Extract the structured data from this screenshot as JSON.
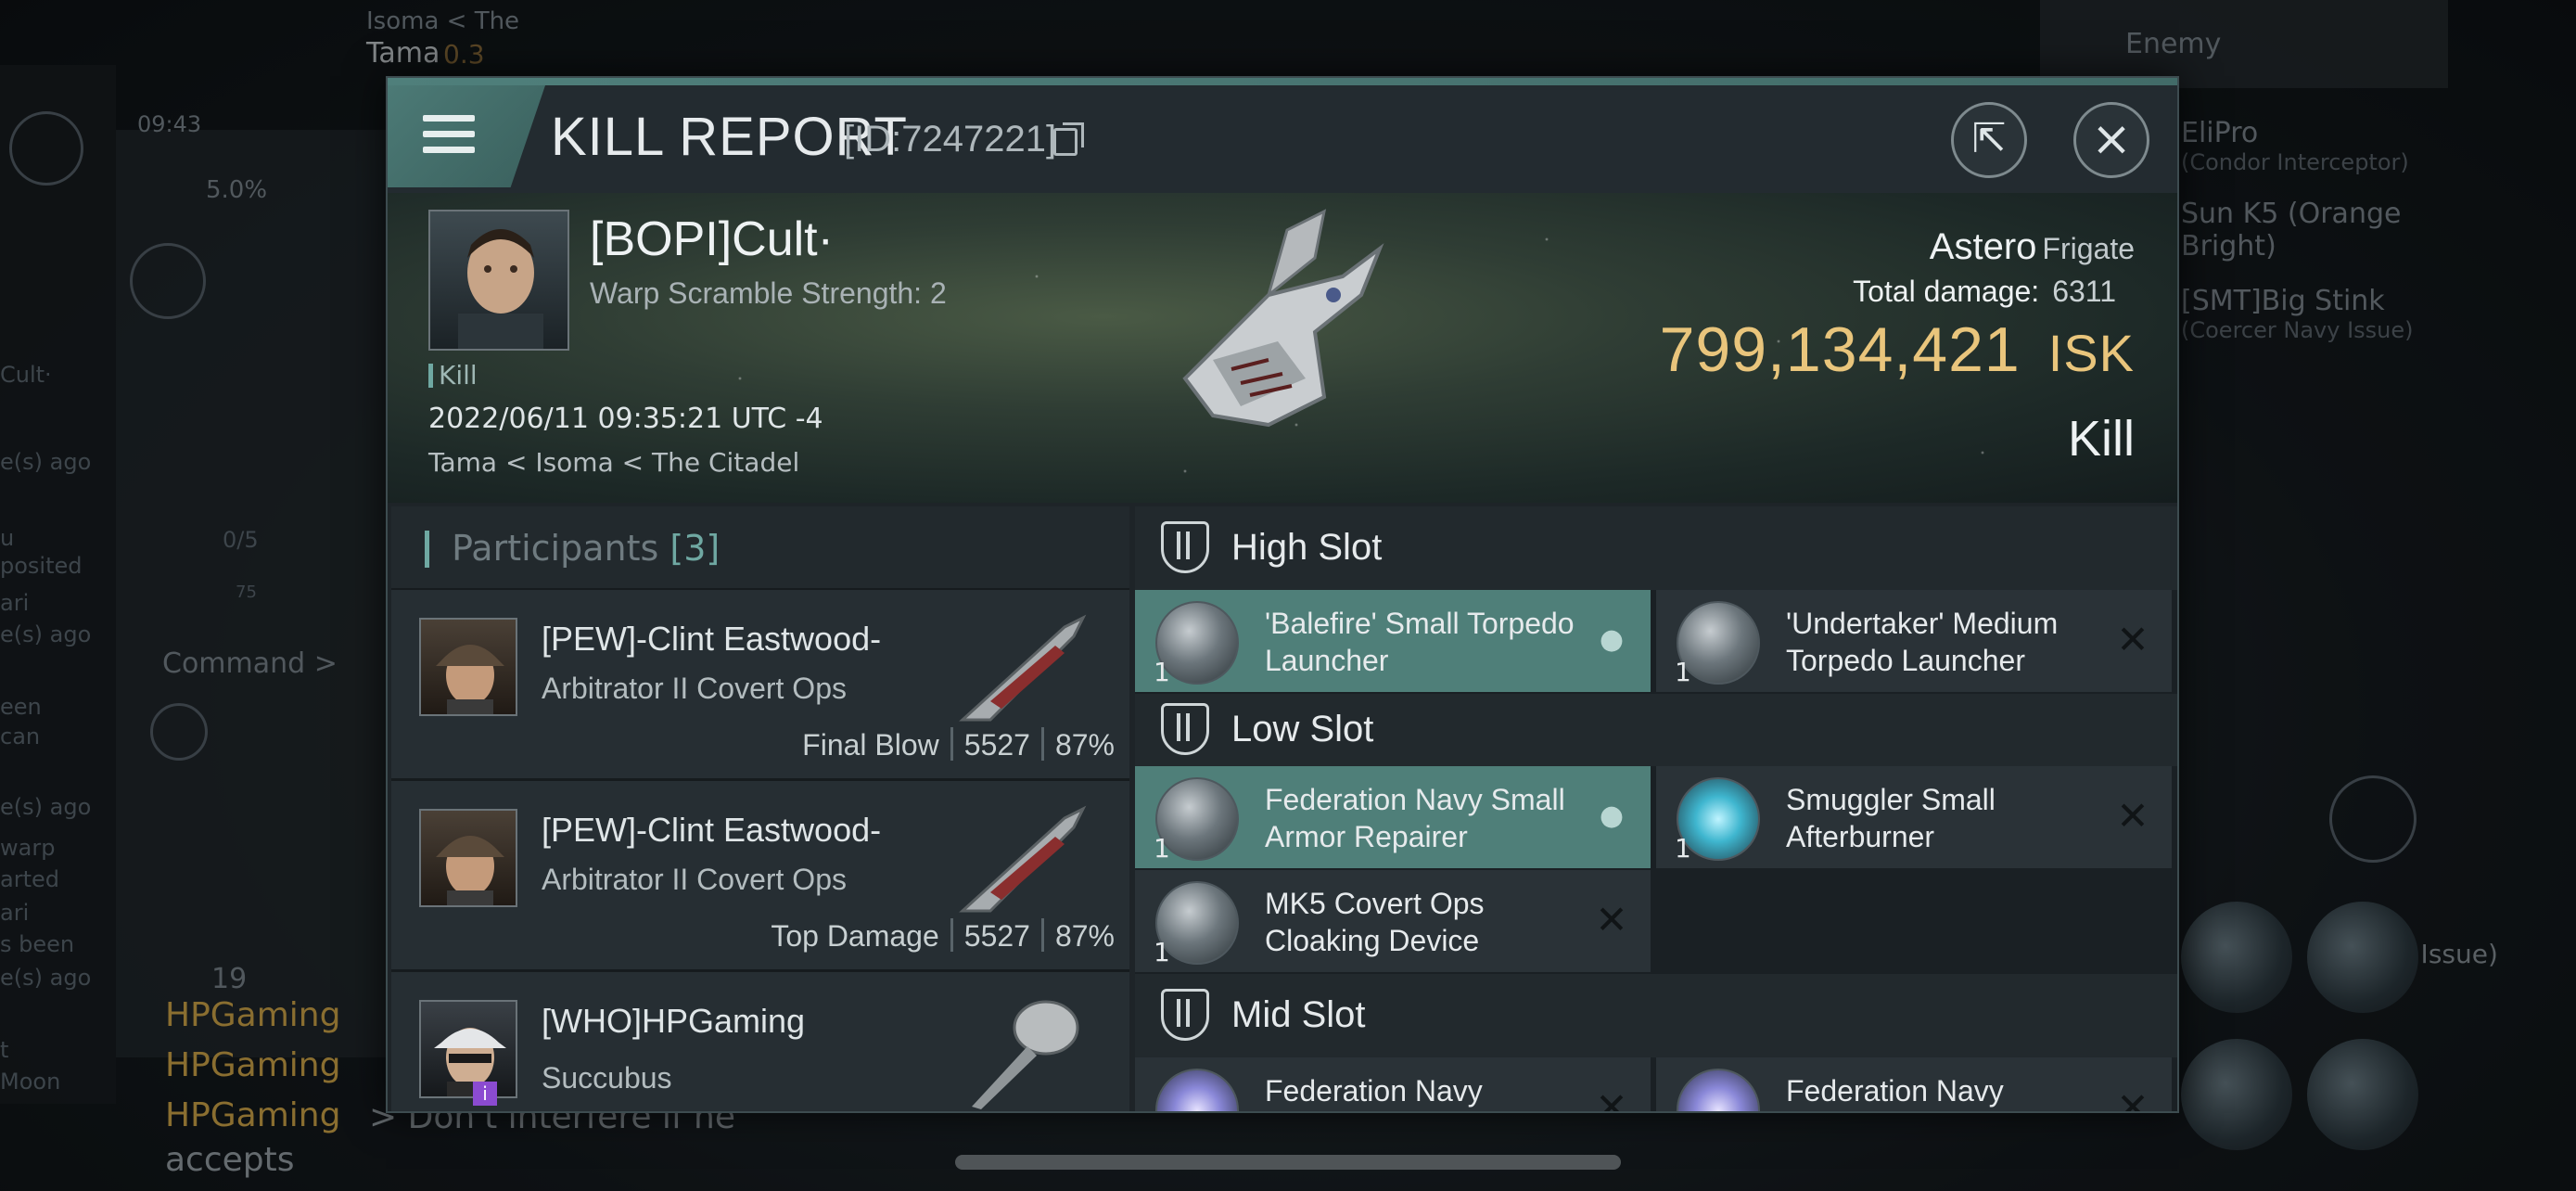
{
  "background": {
    "top_left": {
      "system_line": "Isoma < The",
      "location": "Tama",
      "security": "0.3",
      "clock": "09:43",
      "cargo_pct": "5.0%"
    },
    "chat_snippets": [
      "Cult·",
      "e(s) ago",
      "u",
      "posited",
      "ari",
      "e(s) ago",
      "een",
      "can",
      "e(s) ago",
      "warp",
      "arted",
      "ari",
      "s been",
      "e(s) ago",
      "t",
      "Moon"
    ],
    "command_label": "Command >",
    "slots_count": "0/5",
    "slots_sub": "75",
    "online_count": "19",
    "chat_lines": [
      {
        "sender": "HPGaming",
        "text": ""
      },
      {
        "sender": "HPGaming",
        "text": ""
      },
      {
        "sender": "HPGaming",
        "text": "> Don't interfere if he"
      }
    ],
    "chat_tail": "accepts",
    "filter_label": "Enemy",
    "side_list": [
      {
        "name": "EliPro",
        "ship": "(Condor Interceptor)"
      },
      {
        "name": "Sun K5 (Orange Bright)",
        "ship": ""
      },
      {
        "name": "[SMT]Big Stink",
        "ship": "(Coercer Navy Issue)"
      }
    ],
    "side_fragment": "r Navy Issue)"
  },
  "header": {
    "title": "KILL REPORT",
    "id_text": "[ID:7247221]"
  },
  "victim": {
    "name": "[BOPI]Cult·",
    "detail": "Warp Scramble Strength: 2",
    "tag": "Kill",
    "datetime": "2022/06/11 09:35:21 UTC -4",
    "location": "Tama < Isoma < The Citadel",
    "ship": "Astero",
    "ship_class": "Frigate",
    "damage_label": "Total damage:",
    "damage_value": "6311",
    "isk_value": "799,134,421",
    "isk_unit": "ISK",
    "report_type": "Kill"
  },
  "participants": {
    "label": "Participants",
    "count": "[3]",
    "rows": [
      {
        "name": "[PEW]-Clint Eastwood-",
        "ship": "Arbitrator II Covert Ops",
        "role": "Final Blow",
        "damage": "5527",
        "percent": "87%"
      },
      {
        "name": "[PEW]-Clint Eastwood-",
        "ship": "Arbitrator II Covert Ops",
        "role": "Top Damage",
        "damage": "5527",
        "percent": "87%"
      },
      {
        "name": "[WHO]HPGaming",
        "ship": "Succubus",
        "role": "",
        "damage": "",
        "percent": ""
      }
    ]
  },
  "fittings": {
    "high_slot": {
      "label": "High Slot",
      "modules": [
        {
          "name": "'Balefire' Small Torpedo Launcher",
          "qty": "1",
          "status": "dropped"
        },
        {
          "name": "'Undertaker' Medium Torpedo Launcher",
          "qty": "1",
          "status": "destroyed"
        }
      ]
    },
    "low_slot": {
      "label": "Low Slot",
      "modules": [
        {
          "name": "Federation Navy Small Armor Repairer",
          "qty": "1",
          "status": "dropped"
        },
        {
          "name": "Smuggler Small Afterburner",
          "qty": "1",
          "status": "destroyed"
        },
        {
          "name": "MK5 Covert Ops Cloaking Device",
          "qty": "1",
          "status": "destroyed"
        }
      ]
    },
    "mid_slot": {
      "label": "Mid Slot",
      "modules": [
        {
          "name": "Federation Navy",
          "qty": "",
          "status": "destroyed"
        },
        {
          "name": "Federation Navy",
          "qty": "",
          "status": "destroyed"
        }
      ]
    }
  },
  "colors": {
    "accent_teal": "#4f7f79",
    "isk_gold": "#e9c57c",
    "panel_dark": "#1e2428"
  }
}
